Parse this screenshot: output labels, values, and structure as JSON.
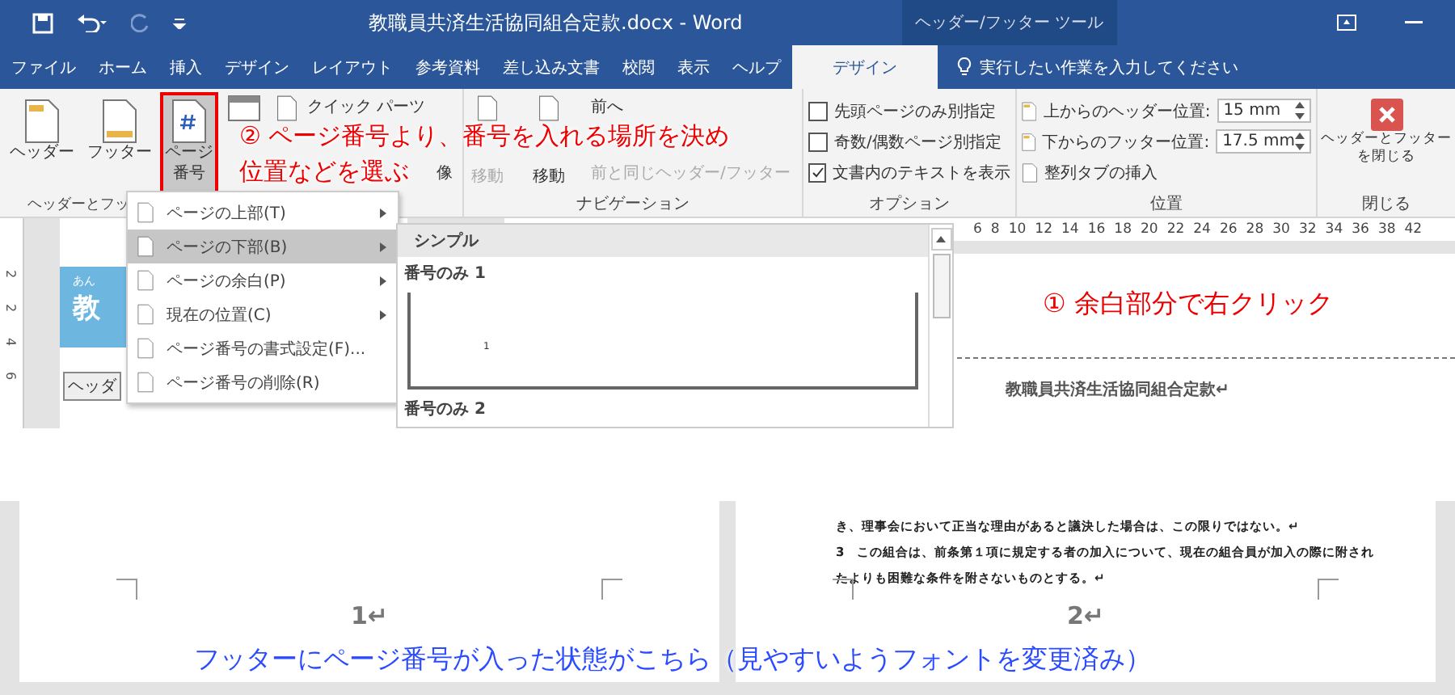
{
  "title_bar": {
    "title": "教職員共済生活協同組合定款.docx  -  Word",
    "context_label": "ヘッダー/フッター ツール"
  },
  "tabs": [
    {
      "label": "ファイル",
      "selected": false
    },
    {
      "label": "ホーム",
      "selected": false
    },
    {
      "label": "挿入",
      "selected": false
    },
    {
      "label": "デザイン",
      "selected": false
    },
    {
      "label": "レイアウト",
      "selected": false
    },
    {
      "label": "参考資料",
      "selected": false
    },
    {
      "label": "差し込み文書",
      "selected": false
    },
    {
      "label": "校閲",
      "selected": false
    },
    {
      "label": "表示",
      "selected": false
    },
    {
      "label": "ヘルプ",
      "selected": false
    },
    {
      "label": "デザイン",
      "selected": true
    }
  ],
  "tell_me": "実行したい作業を入力してください",
  "ribbon": {
    "header_footer": {
      "label": "ヘッダーとフッ",
      "buttons": [
        {
          "lines": [
            "ヘッダー"
          ],
          "highlighted": false
        },
        {
          "lines": [
            "フッター"
          ],
          "highlighted": false
        },
        {
          "lines": [
            "ページ",
            "番号"
          ],
          "highlighted": true
        }
      ],
      "small": [
        "クイック パーツ",
        "像"
      ]
    },
    "navigation": {
      "label": "ナビゲーション",
      "buttons": [
        {
          "lines": [
            "移動"
          ],
          "disabled": true
        },
        {
          "lines": [
            "移動"
          ],
          "disabled": false
        }
      ],
      "small": [
        {
          "label": "前へ",
          "disabled": false
        },
        {
          "label": "前と同じヘッダー/フッター",
          "disabled": true
        }
      ]
    },
    "options": {
      "label": "オプション",
      "checkboxes": [
        {
          "label": "先頭ページのみ別指定",
          "checked": false
        },
        {
          "label": "奇数/偶数ページ別指定",
          "checked": false
        },
        {
          "label": "文書内のテキストを表示",
          "checked": true
        }
      ]
    },
    "position": {
      "label": "位置",
      "fields": [
        {
          "label": "上からのヘッダー位置:",
          "value": "15 mm"
        },
        {
          "label": "下からのフッター位置:",
          "value": "17.5 mm"
        }
      ],
      "insert_tab": "整列タブの挿入"
    },
    "close": {
      "label": "閉じる",
      "button": [
        "ヘッダーとフッター",
        "を閉じる"
      ]
    }
  },
  "menu": [
    {
      "label": "ページの上部(T)",
      "submenu": true,
      "selected": false
    },
    {
      "label": "ページの下部(B)",
      "submenu": true,
      "selected": true
    },
    {
      "label": "ページの余白(P)",
      "submenu": true,
      "selected": false
    },
    {
      "label": "現在の位置(C)",
      "submenu": true,
      "selected": false
    },
    {
      "label": "ページ番号の書式設定(F)...",
      "submenu": false,
      "selected": false
    },
    {
      "label": "ページ番号の削除(R)",
      "submenu": false,
      "selected": false
    }
  ],
  "gallery": {
    "header": "シンプル",
    "items": [
      {
        "title": "番号のみ 1",
        "number": "1"
      },
      {
        "title": "番号のみ 2"
      }
    ]
  },
  "ruler": [
    "6",
    "8",
    "10",
    "12",
    "14",
    "16",
    "18",
    "20",
    "22",
    "24",
    "26",
    "28",
    "30",
    "32",
    "34",
    "36",
    "38",
    "42"
  ],
  "vertical_ruler": [
    "2",
    "2",
    "4",
    "6"
  ],
  "left_page": {
    "kana": "あん",
    "title": "教",
    "tag": "ヘッダ"
  },
  "right_page": {
    "header_text": "教職員共済生活協同組合定款↵"
  },
  "annotations": [
    {
      "lines": [
        "① 余白部分で右クリック"
      ]
    },
    {
      "lines": [
        "② ページ番号より、番号を入れる場所を決め",
        "位置などを選ぶ"
      ]
    }
  ],
  "bottom": {
    "pages": [
      {
        "number": "1↵"
      },
      {
        "lines": [
          "き、理事会において正当な理由があると議決した場合は、この限りではない。↵",
          "3　この組合は、前条第１項に規定する者の加入について、現在の組合員が加入の際に附され",
          "たよりも困難な条件を附さないものとする。↵"
        ],
        "number": "2↵"
      }
    ],
    "caption": "フッターにページ番号が入った状態がこちら（見やすいようフォントを変更済み）"
  }
}
